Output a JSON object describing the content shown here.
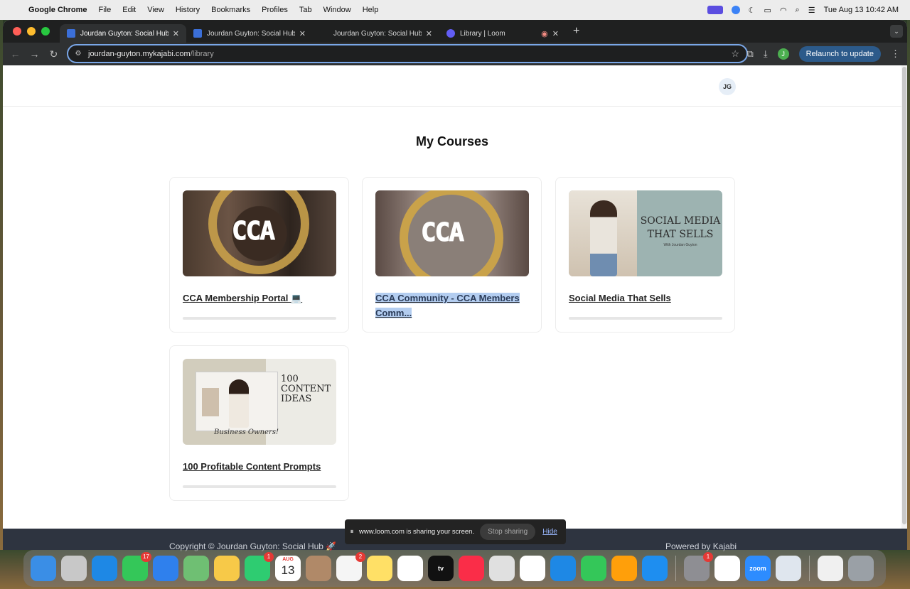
{
  "menubar": {
    "app": "Google Chrome",
    "items": [
      "File",
      "Edit",
      "View",
      "History",
      "Bookmarks",
      "Profiles",
      "Tab",
      "Window",
      "Help"
    ],
    "clock": "Tue Aug 13  10:42 AM"
  },
  "tabs": [
    {
      "title": "Jourdan Guyton: Social Hub –",
      "active": true,
      "favicon_color": "#3b6fd8"
    },
    {
      "title": "Jourdan Guyton: Social Hub 🚀",
      "active": false,
      "favicon_color": "#3b6fd8"
    },
    {
      "title": "Jourdan Guyton: Social Hub 🚀",
      "active": false,
      "favicon_color": "#1f2020"
    },
    {
      "title": "Library | Loom",
      "active": false,
      "favicon_color": "#625df5"
    }
  ],
  "toolbar": {
    "url_host": "jourdan-guyton.mykajabi.com",
    "url_path": "/library",
    "profile_initial": "J",
    "relaunch_label": "Relaunch to update"
  },
  "page": {
    "avatar_initials": "JG",
    "title": "My Courses",
    "courses": [
      {
        "title": "CCA Membership Portal 💻",
        "thumb": "CCA",
        "selected": false
      },
      {
        "title": "CCA Community - CCA Members Comm...",
        "thumb": "CCA",
        "selected": true
      },
      {
        "title": "Social Media That Sells",
        "thumb_text": "SOCIAL MEDIA THAT SELLS",
        "thumb_sub": "With Jourdan Guyton",
        "selected": false
      },
      {
        "title": "100 Profitable Content Prompts",
        "thumb_text": "100 CONTENT IDEAS",
        "thumb_sub": "Business Owners!",
        "selected": false
      }
    ]
  },
  "loom_bar": {
    "message": "www.loom.com is sharing your screen.",
    "stop_label": "Stop sharing",
    "hide_label": "Hide"
  },
  "footer": {
    "copyright": "Copyright © Jourdan Guyton: Social Hub 🚀",
    "powered": "Powered by Kajabi"
  },
  "dock": {
    "apps": [
      {
        "name": "Finder",
        "color": "#3a8ee6",
        "badge": ""
      },
      {
        "name": "Launchpad",
        "color": "#c8c8c8",
        "badge": ""
      },
      {
        "name": "Safari",
        "color": "#1e88e5",
        "badge": ""
      },
      {
        "name": "Messages",
        "color": "#34c759",
        "badge": "17"
      },
      {
        "name": "Mail",
        "color": "#2f80ed",
        "badge": ""
      },
      {
        "name": "Maps",
        "color": "#6fbf73",
        "badge": ""
      },
      {
        "name": "Photos",
        "color": "#f7c948",
        "badge": ""
      },
      {
        "name": "FaceTime",
        "color": "#2ecc71",
        "badge": "1"
      },
      {
        "name": "Calendar",
        "color": "#ffffff",
        "badge": "",
        "month": "AUG",
        "day": "13"
      },
      {
        "name": "Contacts",
        "color": "#b08968",
        "badge": ""
      },
      {
        "name": "Reminders",
        "color": "#f5f5f5",
        "badge": "2"
      },
      {
        "name": "Notes",
        "color": "#ffe066",
        "badge": ""
      },
      {
        "name": "Freeform",
        "color": "#ffffff",
        "badge": ""
      },
      {
        "name": "TV",
        "color": "#111111",
        "badge": "",
        "label": "tv"
      },
      {
        "name": "Music",
        "color": "#fa2d48",
        "badge": ""
      },
      {
        "name": "Chrome",
        "color": "#e0e0e0",
        "badge": ""
      },
      {
        "name": "News",
        "color": "#ffffff",
        "badge": ""
      },
      {
        "name": "Keynote",
        "color": "#1e88e5",
        "badge": ""
      },
      {
        "name": "Numbers",
        "color": "#34c759",
        "badge": ""
      },
      {
        "name": "Pages",
        "color": "#ff9f0a",
        "badge": ""
      },
      {
        "name": "App Store",
        "color": "#1e8ef0",
        "badge": ""
      },
      {
        "name": "System Settings",
        "color": "#8e8e93",
        "badge": "1"
      },
      {
        "name": "Slack",
        "color": "#ffffff",
        "badge": ""
      },
      {
        "name": "Zoom",
        "color": "#2d8cff",
        "badge": "",
        "label": "zoom"
      },
      {
        "name": "Preview",
        "color": "#dfe6ee",
        "badge": ""
      },
      {
        "name": "Document",
        "color": "#f0f0f0",
        "badge": ""
      },
      {
        "name": "Trash",
        "color": "#9aa0a6",
        "badge": ""
      }
    ]
  }
}
